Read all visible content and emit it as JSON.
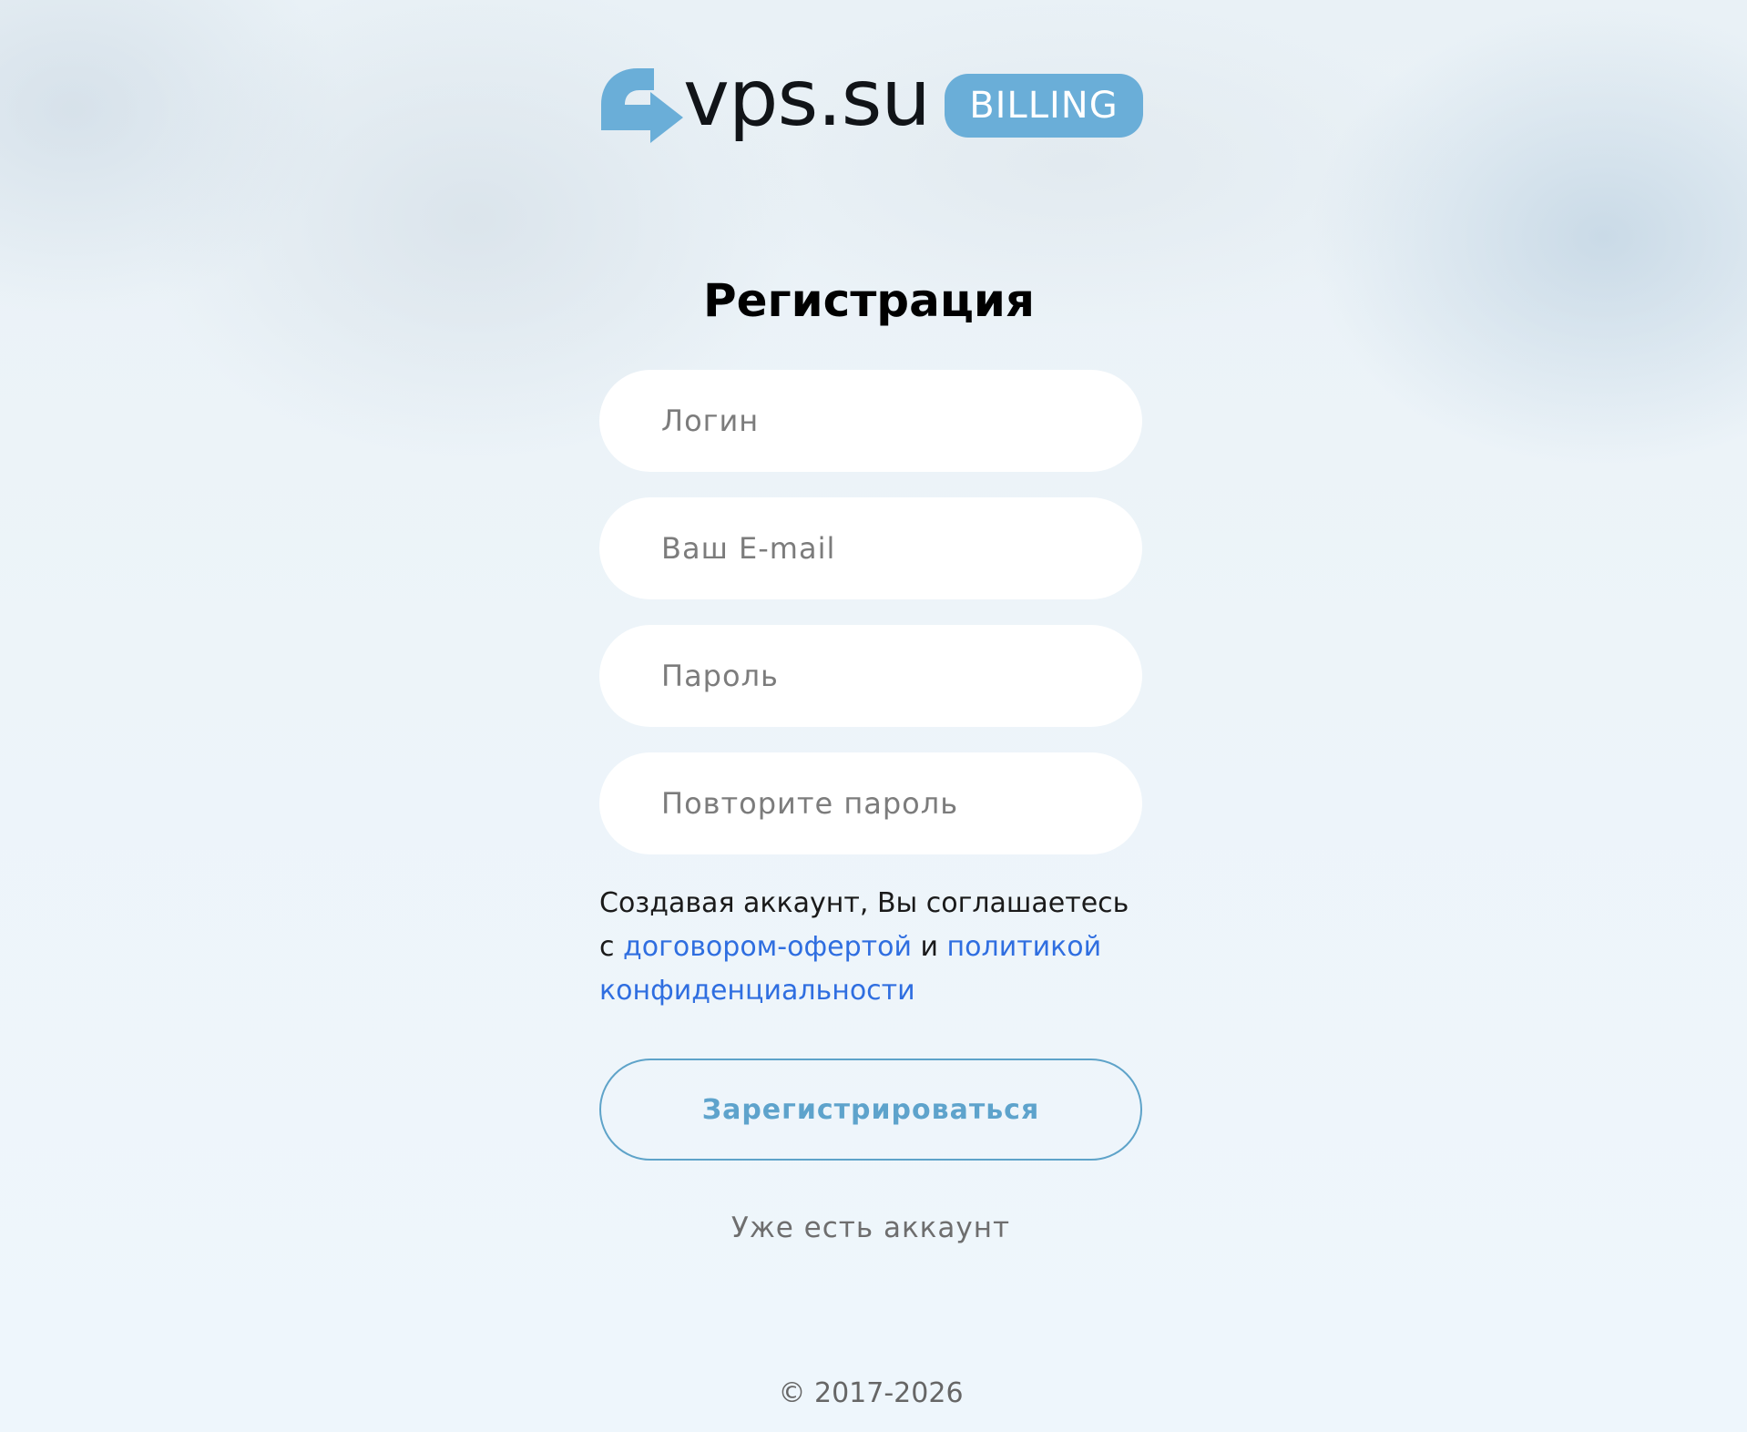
{
  "logo": {
    "text": "vps.su",
    "badge": "BILLING",
    "mark_color": "#6aaed8",
    "badge_color": "#6aaed8"
  },
  "form": {
    "title": "Регистрация",
    "login_placeholder": "Логин",
    "email_placeholder": "Ваш E-mail",
    "password_placeholder": "Пароль",
    "repeat_password_placeholder": "Повторите пароль",
    "agreement": {
      "prefix": "Создавая аккаунт, Вы соглашаетесь с ",
      "offer_link": "договором-офертой",
      "conjunction": " и ",
      "privacy_link": "политикой конфиденциальности"
    },
    "submit_label": "Зарегистрироваться",
    "login_link": "Уже есть аккаунт"
  },
  "footer": {
    "copyright": "© 2017-2026"
  },
  "colors": {
    "link": "#2f6ee0",
    "button_border": "#5ea3c9"
  }
}
